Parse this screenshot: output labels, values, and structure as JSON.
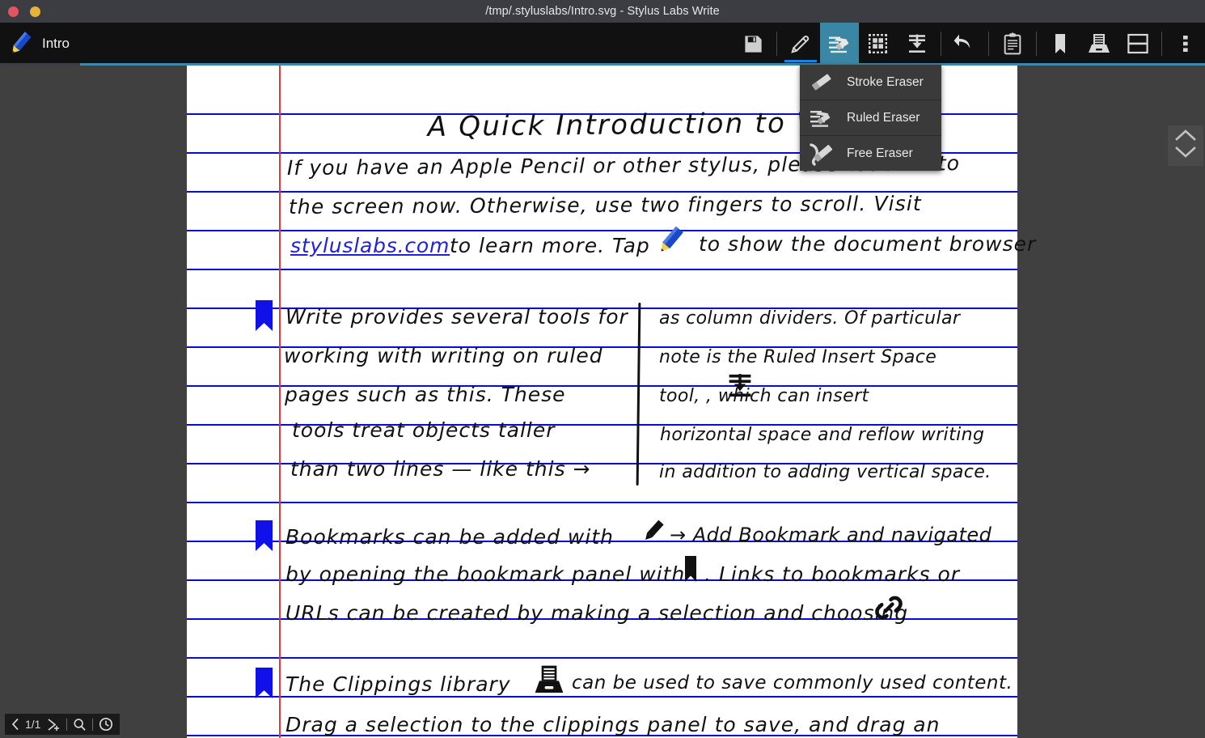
{
  "window": {
    "title": "/tmp/.styluslabs/Intro.svg - Stylus Labs Write",
    "close_label": "close",
    "minimize_label": "minimize"
  },
  "toolbar": {
    "document_name": "Intro",
    "buttons": [
      {
        "name": "save-button",
        "icon": "floppy-disk-icon",
        "label": "Save",
        "active": false
      },
      {
        "name": "pen-tool-button",
        "icon": "pencil-icon",
        "label": "Pen",
        "active": true
      },
      {
        "name": "eraser-tool-button",
        "icon": "ruled-eraser-icon",
        "label": "Eraser",
        "active": true
      },
      {
        "name": "select-tool-button",
        "icon": "selection-grid-icon",
        "label": "Select",
        "active": false
      },
      {
        "name": "insert-space-button",
        "icon": "insert-space-icon",
        "label": "Insert Space",
        "active": false
      },
      {
        "name": "undo-button",
        "icon": "undo-arrow-icon",
        "label": "Undo",
        "active": false
      },
      {
        "name": "clipboard-button",
        "icon": "clipboard-icon",
        "label": "Clipboard",
        "active": false
      },
      {
        "name": "bookmark-button",
        "icon": "bookmark-icon",
        "label": "Bookmarks",
        "active": false
      },
      {
        "name": "clippings-button",
        "icon": "clippings-tray-icon",
        "label": "Clippings",
        "active": false
      },
      {
        "name": "split-view-button",
        "icon": "split-view-icon",
        "label": "Split View",
        "active": false
      },
      {
        "name": "overflow-menu-button",
        "icon": "kebab-menu-icon",
        "label": "More",
        "active": false
      }
    ]
  },
  "eraser_menu": {
    "visible": true,
    "items": [
      {
        "label": "Stroke Eraser",
        "icon": "stroke-eraser-icon"
      },
      {
        "label": "Ruled Eraser",
        "icon": "ruled-eraser-icon"
      },
      {
        "label": "Free Eraser",
        "icon": "free-eraser-icon"
      }
    ]
  },
  "statusbar": {
    "prev_label": "‹",
    "page_indicator": "1/1",
    "add_page_label": "add-page",
    "search_label": "search",
    "history_label": "history"
  },
  "scroll_widget": {
    "up_label": "scroll-up",
    "down_label": "scroll-down"
  },
  "colors": {
    "accent": "#3a8aa8",
    "active_underline": "#1e84e0",
    "rule_line": "#0a0ad8",
    "margin_line": "#e03a3a",
    "bookmark": "#1010e8",
    "link_ink": "#2020dd",
    "ink": "#111111",
    "page": "#ffffff",
    "workspace": "#404040",
    "titlebar": "#3b3d42",
    "toolbar": "#111111"
  },
  "document": {
    "title_line": "A Quick Introduction to Writ",
    "intro_lines": [
      "If you have an Apple Pencil or other stylus, please touch it to",
      "the screen now.  Otherwise, use two fingers to scroll.  Visit"
    ],
    "link_text": "styluslabs.com",
    "intro_line3_after_link": "to learn more.  Tap",
    "intro_line3_tail": "to show the document browser",
    "sections": [
      {
        "bookmark": true,
        "left_column": [
          "Write provides several tools for",
          "working with writing on ruled",
          "pages such as this.  These",
          "tools treat objects taller",
          "than two lines — like this →"
        ],
        "right_column": [
          "as column dividers. Of particular",
          "note is the Ruled Insert Space",
          "tool,         , which can insert",
          "horizontal space and reflow writing",
          "in addition to adding vertical space."
        ],
        "right_column_inline_icon": "insert-space-icon"
      },
      {
        "bookmark": true,
        "lines": [
          "Bookmarks can be added with",
          "→ Add Bookmark and navigated",
          "by opening the bookmark panel with",
          ".  Links to bookmarks or",
          "URLs can be created by making a selection and choosing"
        ],
        "inline_icons": [
          "pencil-icon",
          "bookmark-icon",
          "link-icon"
        ]
      },
      {
        "bookmark": true,
        "lines": [
          "The Clippings library",
          "can be used to save commonly used content.",
          "Drag a selection to the clippings panel to save, and drag an"
        ],
        "inline_icons": [
          "clippings-tray-icon"
        ]
      }
    ]
  }
}
